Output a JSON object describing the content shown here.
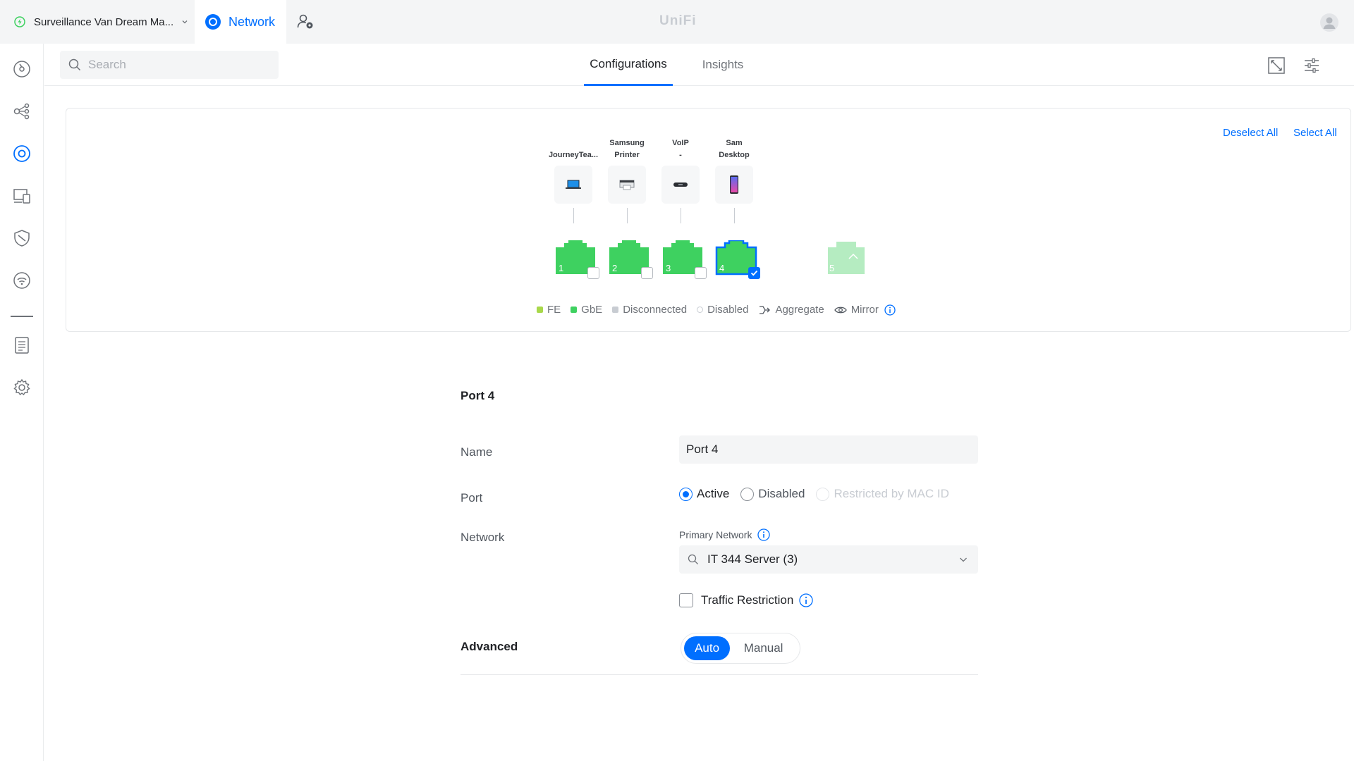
{
  "topbar": {
    "site_name": "Surveillance Van Dream Ma...",
    "app_name": "Network",
    "brand": "UniFi"
  },
  "search": {
    "placeholder": "Search"
  },
  "tabs": [
    {
      "label": "Configurations",
      "active": true
    },
    {
      "label": "Insights",
      "active": false
    }
  ],
  "panel": {
    "deselect_all": "Deselect All",
    "select_all": "Select All",
    "devices": [
      {
        "name_line1": "JourneyTea...",
        "name_line2": "",
        "icon": "laptop-icon"
      },
      {
        "name_line1": "Samsung",
        "name_line2": "Printer",
        "icon": "printer-icon"
      },
      {
        "name_line1": "VoIP",
        "name_line2": "-",
        "icon": "voip-phone-icon"
      },
      {
        "name_line1": "Sam",
        "name_line2": "Desktop",
        "icon": "phone-icon"
      }
    ],
    "ports": [
      {
        "number": "1",
        "status": "GbE",
        "selected": false
      },
      {
        "number": "2",
        "status": "GbE",
        "selected": false
      },
      {
        "number": "3",
        "status": "GbE",
        "selected": false
      },
      {
        "number": "4",
        "status": "GbE",
        "selected": true
      },
      {
        "number": "5",
        "status": "SFP",
        "selected": false
      }
    ],
    "legend": {
      "fe": "FE",
      "gbe": "GbE",
      "disconnected": "Disconnected",
      "disabled": "Disabled",
      "aggregate": "Aggregate",
      "mirror": "Mirror"
    }
  },
  "form": {
    "title": "Port 4",
    "name_label": "Name",
    "name_value": "Port 4",
    "port_label": "Port",
    "port_options": [
      "Active",
      "Disabled",
      "Restricted by MAC ID"
    ],
    "port_selected": "Active",
    "network_label": "Network",
    "primary_network_label": "Primary Network",
    "primary_network_value": "IT 344 Server (3)",
    "traffic_restriction_label": "Traffic Restriction",
    "advanced_label": "Advanced",
    "advanced_options": [
      "Auto",
      "Manual"
    ],
    "advanced_selected": "Auto"
  },
  "colors": {
    "accent": "#006fff",
    "gbe": "#3ed160",
    "fe": "#a8d84a",
    "disconnected": "#c8ccd2",
    "sfp_faded": "#b5ecc1"
  }
}
